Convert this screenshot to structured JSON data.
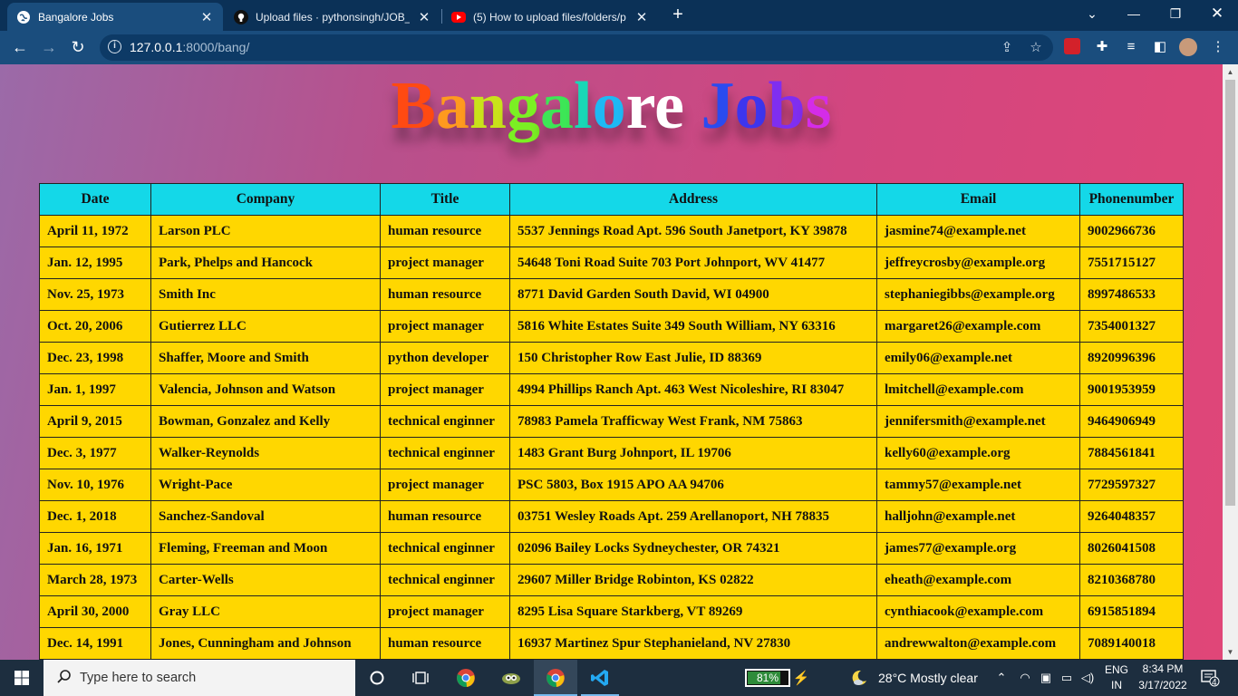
{
  "browser": {
    "tabs": [
      {
        "title": "Bangalore Jobs",
        "icon": "globe-icon",
        "active": true
      },
      {
        "title": "Upload files · pythonsingh/JOB_P",
        "icon": "github-icon",
        "active": false
      },
      {
        "title": "(5) How to upload files/folders/p",
        "icon": "youtube-icon",
        "active": false
      }
    ],
    "url_host": "127.0.0.1",
    "url_path": ":8000/bang/"
  },
  "page": {
    "title": "Bangalore Jobs",
    "title_colors": [
      "#ff4a12",
      "#ff9a1e",
      "#c9e21a",
      "#7bf023",
      "#3de656",
      "#19d7b6",
      "#1eb9f4",
      "#ffffff",
      "#ffffff",
      "#2a4bf0",
      "#3d35ee",
      "#7f2ef0",
      "#d42ce8",
      "#ff2bb0"
    ]
  },
  "table": {
    "headers": [
      "Date",
      "Company",
      "Title",
      "Address",
      "Email",
      "Phonenumber"
    ],
    "rows": [
      [
        "April 11, 1972",
        "Larson PLC",
        "human resource",
        "5537 Jennings Road Apt. 596 South Janetport, KY 39878",
        "jasmine74@example.net",
        "9002966736"
      ],
      [
        "Jan. 12, 1995",
        "Park, Phelps and Hancock",
        "project manager",
        "54648 Toni Road Suite 703 Port Johnport, WV 41477",
        "jeffreycrosby@example.org",
        "7551715127"
      ],
      [
        "Nov. 25, 1973",
        "Smith Inc",
        "human resource",
        "8771 David Garden South David, WI 04900",
        "stephaniegibbs@example.org",
        "8997486533"
      ],
      [
        "Oct. 20, 2006",
        "Gutierrez LLC",
        "project manager",
        "5816 White Estates Suite 349 South William, NY 63316",
        "margaret26@example.com",
        "7354001327"
      ],
      [
        "Dec. 23, 1998",
        "Shaffer, Moore and Smith",
        "python developer",
        "150 Christopher Row East Julie, ID 88369",
        "emily06@example.net",
        "8920996396"
      ],
      [
        "Jan. 1, 1997",
        "Valencia, Johnson and Watson",
        "project manager",
        "4994 Phillips Ranch Apt. 463 West Nicoleshire, RI 83047",
        "lmitchell@example.com",
        "9001953959"
      ],
      [
        "April 9, 2015",
        "Bowman, Gonzalez and Kelly",
        "technical enginner",
        "78983 Pamela Trafficway West Frank, NM 75863",
        "jennifersmith@example.net",
        "9464906949"
      ],
      [
        "Dec. 3, 1977",
        "Walker-Reynolds",
        "technical enginner",
        "1483 Grant Burg Johnport, IL 19706",
        "kelly60@example.org",
        "7884561841"
      ],
      [
        "Nov. 10, 1976",
        "Wright-Pace",
        "project manager",
        "PSC 5803, Box 1915 APO AA 94706",
        "tammy57@example.net",
        "7729597327"
      ],
      [
        "Dec. 1, 2018",
        "Sanchez-Sandoval",
        "human resource",
        "03751 Wesley Roads Apt. 259 Arellanoport, NH 78835",
        "halljohn@example.net",
        "9264048357"
      ],
      [
        "Jan. 16, 1971",
        "Fleming, Freeman and Moon",
        "technical enginner",
        "02096 Bailey Locks Sydneychester, OR 74321",
        "james77@example.org",
        "8026041508"
      ],
      [
        "March 28, 1973",
        "Carter-Wells",
        "technical enginner",
        "29607 Miller Bridge Robinton, KS 02822",
        "eheath@example.com",
        "8210368780"
      ],
      [
        "April 30, 2000",
        "Gray LLC",
        "project manager",
        "8295 Lisa Square Starkberg, VT 89269",
        "cynthiacook@example.com",
        "6915851894"
      ],
      [
        "Dec. 14, 1991",
        "Jones, Cunningham and Johnson",
        "human resource",
        "16937 Martinez Spur Stephanieland, NV 27830",
        "andrewwalton@example.com",
        "7089140018"
      ]
    ]
  },
  "taskbar": {
    "search_placeholder": "Type here to search",
    "battery": "81%",
    "battery_level": 0.81,
    "weather": "28°C  Mostly clear",
    "lang_top": "ENG",
    "lang_bottom": "IN",
    "time": "8:34 PM",
    "date": "3/17/2022",
    "notifications": "4"
  }
}
